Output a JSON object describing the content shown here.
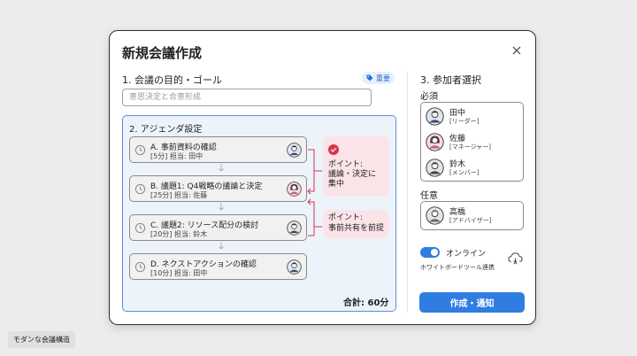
{
  "dialog": {
    "title": "新規会議作成"
  },
  "goal": {
    "label": "1. 会議の目的・ゴール",
    "badge": "重要",
    "placeholder": "意思決定と合意形成"
  },
  "agenda": {
    "label": "2. アジェンダ設定",
    "items": [
      {
        "title": "A. 事前資料の確認",
        "meta": "[5分] 担当: 田中",
        "avatar": "male-avatar-icon"
      },
      {
        "title": "B. 議題1: Q4戦略の議論と決定",
        "meta": "[25分] 担当: 佐藤",
        "avatar": "female-avatar-icon"
      },
      {
        "title": "C. 議題2: リソース配分の検討",
        "meta": "[20分] 担当: 鈴木",
        "avatar": "male-avatar-icon"
      },
      {
        "title": "D. ネクストアクションの確認",
        "meta": "[10分] 担当: 田中",
        "avatar": "male-avatar-icon"
      }
    ],
    "points": [
      {
        "line1": "ポイント:",
        "line2": "議論・決定に",
        "line3": "集中"
      },
      {
        "line1": "ポイント:",
        "line2": "事前共有を前提"
      }
    ],
    "total": "合計: 60分"
  },
  "participants": {
    "label": "3. 参加者選択",
    "required_label": "必須",
    "required": [
      {
        "name": "田中",
        "role": "[リーダー]"
      },
      {
        "name": "佐藤",
        "role": "[マネージャー]"
      },
      {
        "name": "鈴木",
        "role": "[メンバー]"
      }
    ],
    "optional_label": "任意",
    "optional": [
      {
        "name": "高橋",
        "role": "[アドバイザー]"
      }
    ]
  },
  "online": {
    "label": "オンライン",
    "sub": "ホワイトボードツール連携",
    "enabled": true
  },
  "actions": {
    "submit": "作成・通知"
  },
  "footer": {
    "tag": "モダンな会議構造"
  },
  "colors": {
    "accent": "#2f7de1",
    "point_bg": "#fbe4e8",
    "point_check": "#d8344e",
    "agenda_bg": "#edf3fb"
  }
}
